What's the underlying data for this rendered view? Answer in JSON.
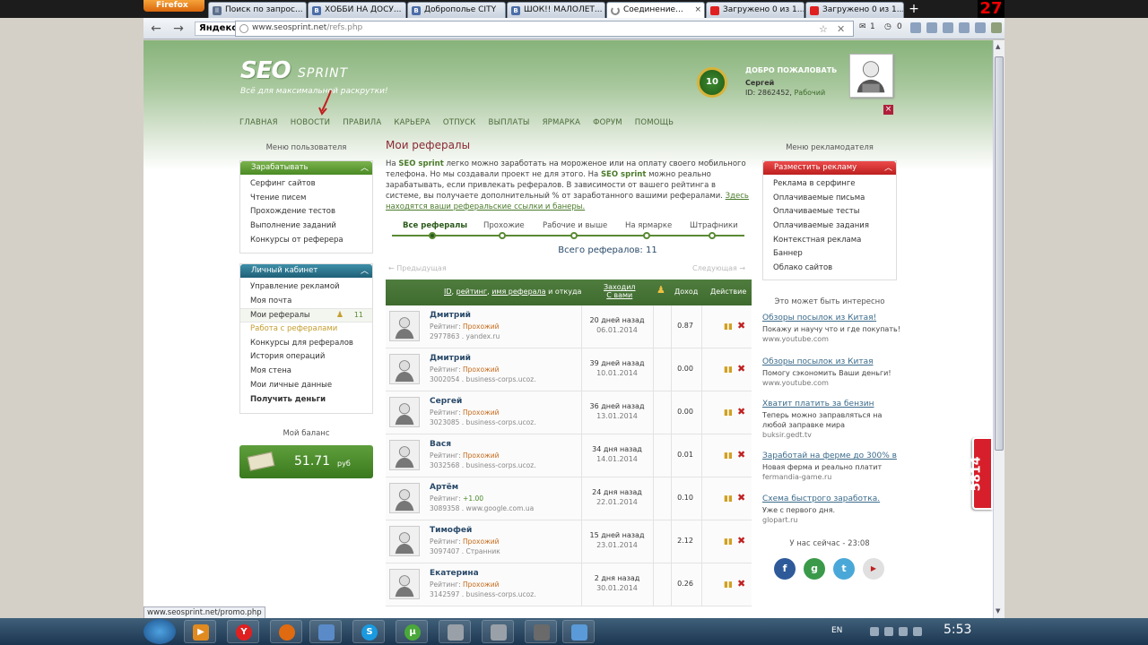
{
  "browser": {
    "app_button": "Firefox",
    "tab_counter": "27",
    "tabs": [
      {
        "title": "Поиск по запрос...",
        "icon": "pause-icon"
      },
      {
        "title": "ХОББИ НА ДОСУ...",
        "icon": "vk-icon"
      },
      {
        "title": "Доброполье CITY",
        "icon": "vk-icon"
      },
      {
        "title": "ШОК!! МАЛОЛЕТ...",
        "icon": "vk-icon"
      },
      {
        "title": "Соединение...",
        "icon": "loading-icon"
      },
      {
        "title": "Загружено 0 из 1...",
        "icon": "youtube-icon"
      },
      {
        "title": "Загружено 0 из 1...",
        "icon": "youtube-icon"
      }
    ],
    "yandex_label": "Яндекс",
    "url_host": "www.seosprint.net",
    "url_path": "/refs.php",
    "toolbar_counts": {
      "mail": "1",
      "clock": "0"
    },
    "status_url": "www.seosprint.net/promo.php"
  },
  "site": {
    "logo": "SEO",
    "logo_sprint": "SPRINT",
    "slogan": "Всё для максимальной раскрутки!",
    "level": "10",
    "welcome": "ДОБРО ПОЖАЛОВАТЬ",
    "user_name": "Сергей",
    "user_id_label": "ID: 2862452,",
    "user_status": "Рабочий",
    "menu": [
      "ГЛАВНАЯ",
      "НОВОСТИ",
      "ПРАВИЛА",
      "КАРЬЕРА",
      "ОТПУСК",
      "ВЫПЛАТЫ",
      "ЯРМАРКА",
      "ФОРУМ",
      "ПОМОЩЬ"
    ]
  },
  "left": {
    "user_menu_title": "Меню пользователя",
    "earn_title": "Зарабатывать",
    "earn_items": [
      "Серфинг сайтов",
      "Чтение писем",
      "Прохождение тестов",
      "Выполнение заданий",
      "Конкурсы от реферера"
    ],
    "cabinet_title": "Личный кабинет",
    "cabinet_items": [
      "Управление рекламой",
      "Моя почта",
      "Мои рефералы",
      "Работа с рефералами",
      "Конкурсы для рефералов",
      "История операций",
      "Моя стена",
      "Мои личные данные",
      "Получить деньги"
    ],
    "my_referrals_count": "11",
    "balance_title": "Мой баланс",
    "balance_value": "51.71",
    "balance_currency": "руб"
  },
  "center": {
    "title": "Мои рефералы",
    "intro": {
      "p1": "На ",
      "brand1": "SEO sprint",
      "p2": " легко можно заработать на мороженое или на оплату своего мобильного телефона. Но мы создавали проект не для этого. На ",
      "brand2": "SEO sprint",
      "p3": " можно реально зарабатывать, если привлекать рефералов. В зависимости от вашего рейтинга в системе, вы получаете дополнительный % от заработанного вашими рефералами. ",
      "link": "Здесь находятся ваши реферальские ссылки и банеры."
    },
    "tabs": [
      "Все рефералы",
      "Прохожие",
      "Рабочие и выше",
      "На ярмарке",
      "Штрафники"
    ],
    "total": "Всего рефералов: 11",
    "prev": "← Предыдущая",
    "next": "Следующая →",
    "table_head": {
      "id": "ID",
      "rating": "рейтинг",
      "sep1": ", ",
      "sep2": " и откуда",
      "ref_name": "имя реферала",
      "visited_1": "Заходил",
      "visited_2": "С вами",
      "income": "Доход",
      "action": "Действие"
    },
    "rating_label": "Рейтинг:",
    "rows": [
      {
        "name": "Дмитрий",
        "rating": "Прохожий",
        "id_from": "2977863 . yandex.ru",
        "ago": "20 дней назад",
        "date": "06.01.2014",
        "income": "0.87"
      },
      {
        "name": "Дмитрий",
        "rating": "Прохожий",
        "id_from": "3002054 . business-corps.ucoz.",
        "ago": "39 дней назад",
        "date": "10.01.2014",
        "income": "0.00"
      },
      {
        "name": "Сергей",
        "rating": "Прохожий",
        "id_from": "3023085 . business-corps.ucoz.",
        "ago": "36 дней назад",
        "date": "13.01.2014",
        "income": "0.00"
      },
      {
        "name": "Вася",
        "rating": "Прохожий",
        "id_from": "3032568 . business-corps.ucoz.",
        "ago": "34 дня назад",
        "date": "14.01.2014",
        "income": "0.01"
      },
      {
        "name": "Артём",
        "rating": "+1.00",
        "id_from": "3089358 . www.google.com.ua",
        "ago": "24 дня назад",
        "date": "22.01.2014",
        "income": "0.10"
      },
      {
        "name": "Тимофей",
        "rating": "Прохожий",
        "id_from": "3097407 . Странник",
        "ago": "15 дней назад",
        "date": "23.01.2014",
        "income": "2.12"
      },
      {
        "name": "Екатерина",
        "rating": "Прохожий",
        "id_from": "3142597 . business-corps.ucoz.",
        "ago": "2 дня назад",
        "date": "30.01.2014",
        "income": "0.26"
      }
    ]
  },
  "right": {
    "adv_menu_title": "Меню рекламодателя",
    "place_ad": "Разместить рекламу",
    "ad_items": [
      "Реклама в серфинге",
      "Оплачиваемые письма",
      "Оплачиваемые тесты",
      "Оплачиваемые задания",
      "Контекстная реклама",
      "Баннер",
      "Облако сайтов"
    ],
    "interesting_title": "Это может быть интересно",
    "promos": [
      {
        "title": "Обзоры посылок из Китая!",
        "desc": "Покажу и научу что и где покупать!",
        "url": "www.youtube.com"
      },
      {
        "title": "Обзоры посылок из Китая",
        "desc": "Помогу сэкономить Ваши деньги!",
        "url": "www.youtube.com"
      },
      {
        "title": "Хватит платить за бензин",
        "desc": "Теперь можно заправляться на любой заправке мира",
        "url": "buksir.gedt.tv"
      },
      {
        "title": "Заработай на ферме до 300% в",
        "desc": "Новая ферма и реально платит",
        "url": "fermandia-game.ru"
      },
      {
        "title": "Схема быстрого заработка.",
        "desc": "Уже с первого дня.",
        "url": "glopart.ru"
      }
    ],
    "now_title": "У нас сейчас - 23:08",
    "badge": "5814"
  },
  "taskbar": {
    "lang": "EN",
    "clock": "5:53"
  }
}
